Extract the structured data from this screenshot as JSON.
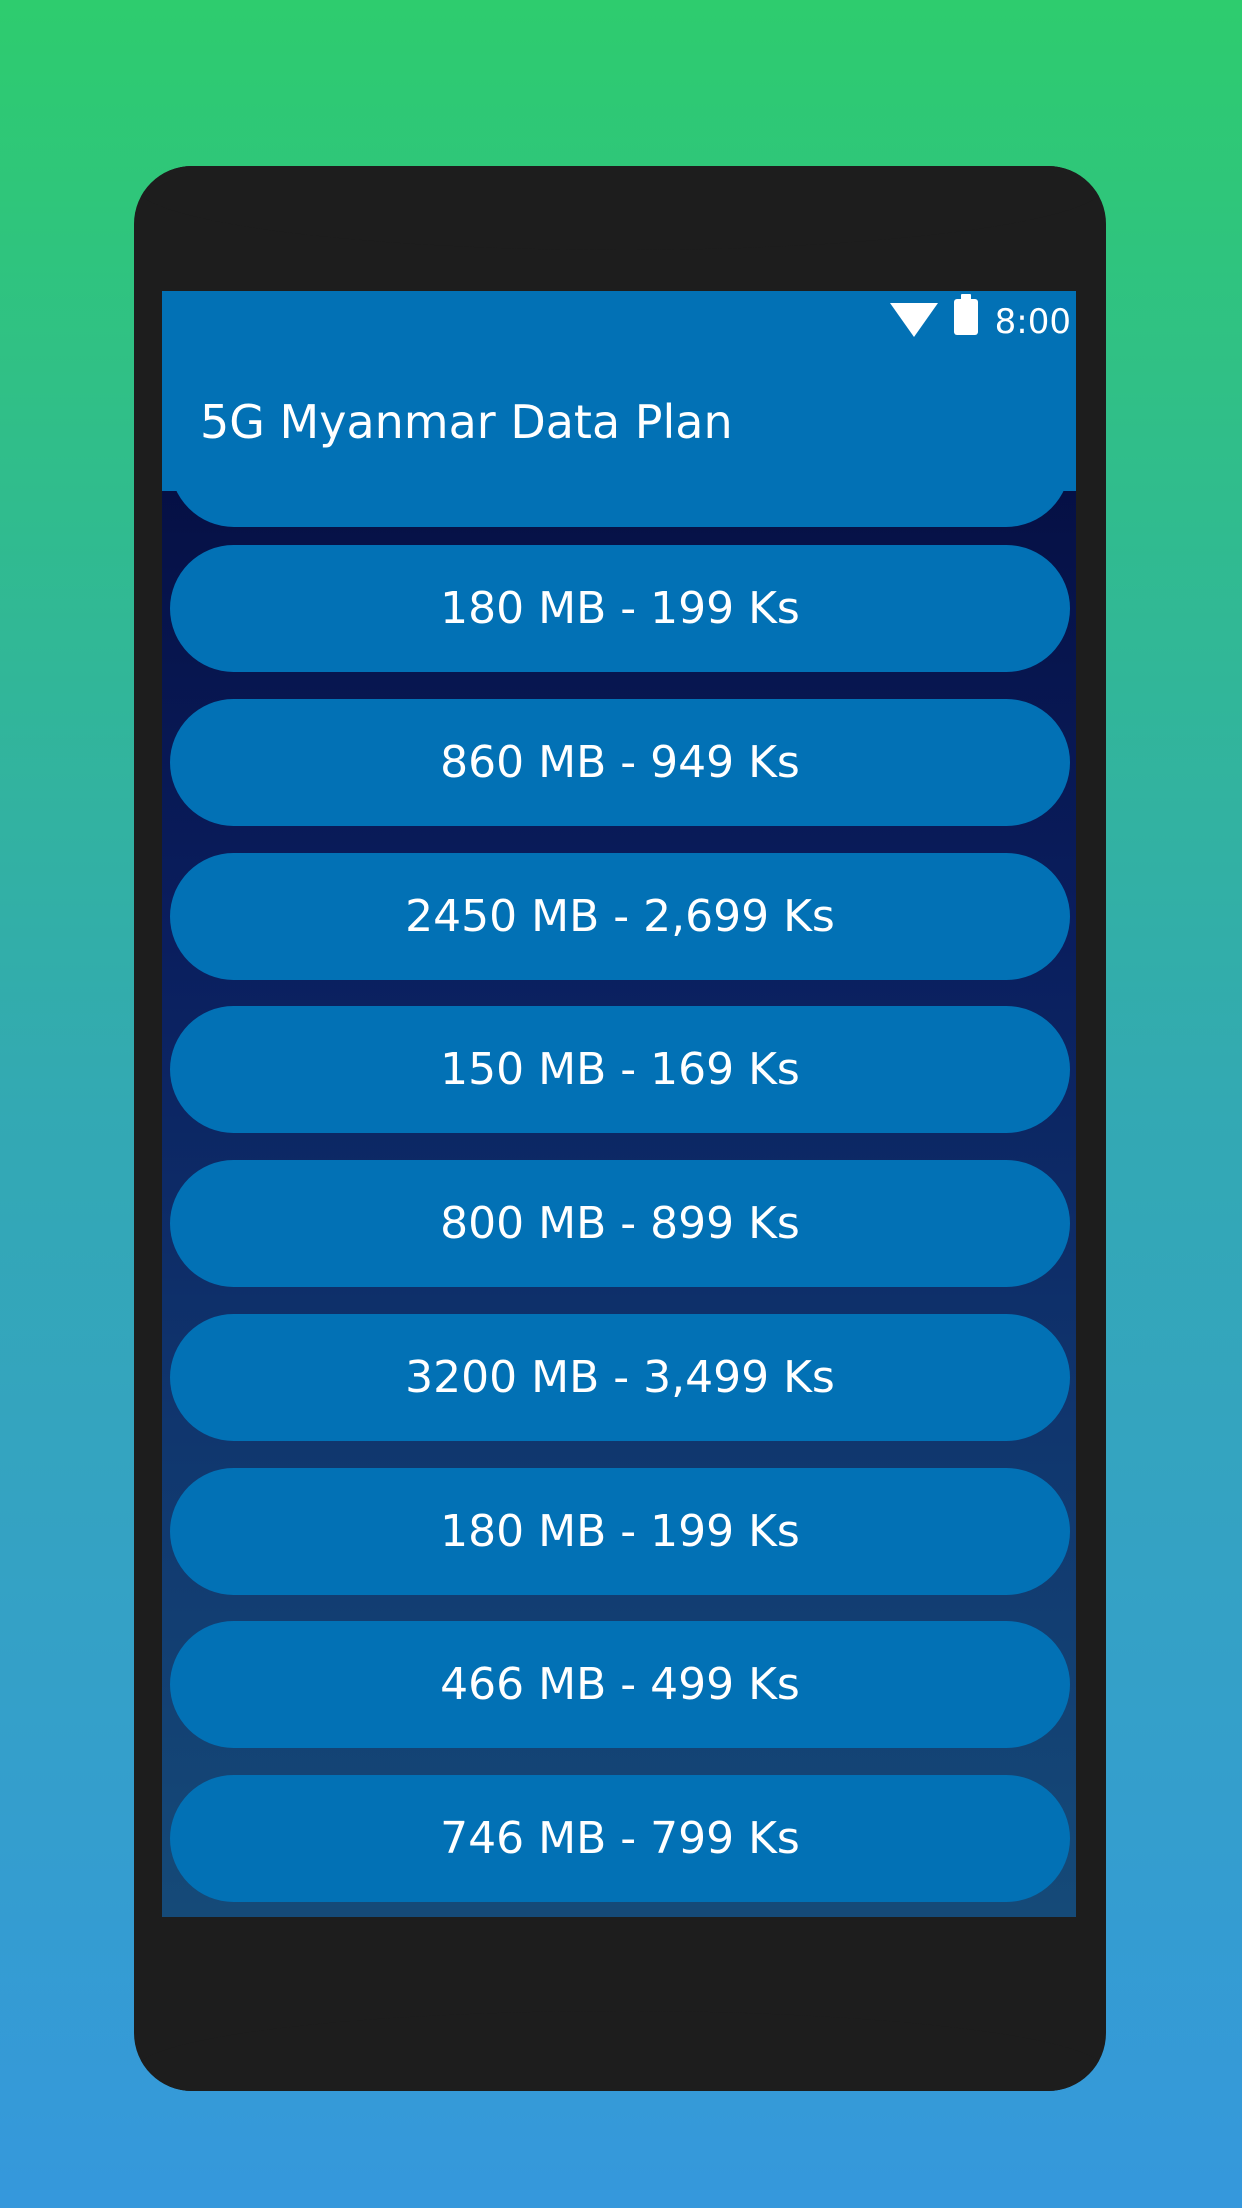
{
  "status_bar": {
    "time": "8:00",
    "icons": [
      "wifi-icon",
      "battery-icon"
    ]
  },
  "app_bar": {
    "title": "5G Myanmar Data Plan"
  },
  "plans": [
    {
      "label": "180 MB - 199 Ks"
    },
    {
      "label": "860 MB - 949 Ks"
    },
    {
      "label": "2450 MB - 2,699 Ks"
    },
    {
      "label": "150 MB - 169 Ks"
    },
    {
      "label": "800 MB - 899 Ks"
    },
    {
      "label": "3200 MB - 3,499 Ks"
    },
    {
      "label": "180 MB - 199 Ks"
    },
    {
      "label": "466 MB - 499 Ks"
    },
    {
      "label": "746 MB - 799 Ks"
    }
  ],
  "colors": {
    "background_top": "#2ecc6e",
    "background_bottom": "#3598dc",
    "phone_frame": "#1d1d1d",
    "primary": "#0271b5",
    "list_background": "#030a3a"
  }
}
